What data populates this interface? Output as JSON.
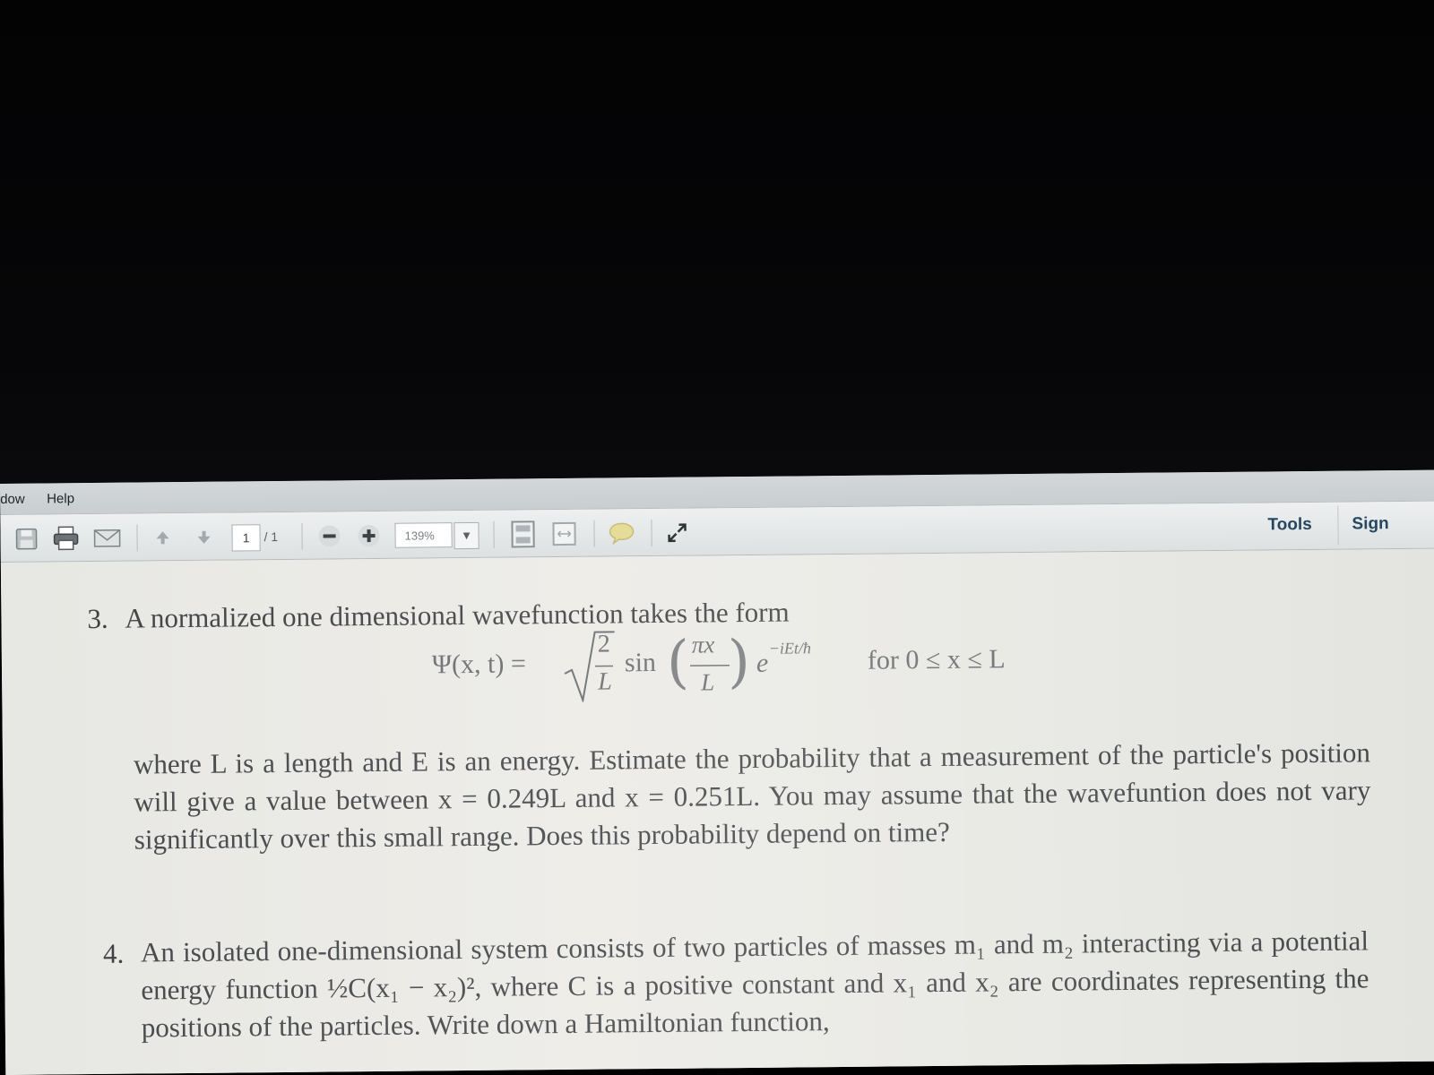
{
  "menu": {
    "items": [
      "dow",
      "Help"
    ]
  },
  "toolbar": {
    "page_current": "1",
    "page_total": "/ 1",
    "zoom": "139%",
    "tools_label": "Tools",
    "sign_label": "Sign"
  },
  "document": {
    "problem3": {
      "number": "3.",
      "intro": "A normalized one dimensional wavefunction takes the form",
      "equation": {
        "lhs": "Ψ(x, t) =",
        "sqrt_num": "2",
        "sqrt_den": "L",
        "sin": "sin",
        "frac_num": "πx",
        "frac_den": "L",
        "exp_base": "e",
        "exp_power": "−iEt/ħ",
        "condition": "for  0 ≤ x ≤ L"
      },
      "body": "where L is a length and E is an energy. Estimate the probability that a measurement of the particle's position will give a value between x = 0.249L and x = 0.251L. You may assume that the wavefuntion does not vary significantly over this small range. Does this probability depend on time?"
    },
    "problem4": {
      "number": "4.",
      "body": "An isolated one-dimensional system consists of two particles of masses m₁ and m₂ interacting via a potential energy function ½C(x₁ − x₂)², where C is a positive constant and x₁ and x₂ are coordinates representing the positions of the particles. Write down a Hamiltonian function,"
    }
  },
  "colors": {
    "toolbar_bg": "#e4e6e6",
    "document_bg": "#ecebe6",
    "accent_text": "#26475f"
  }
}
